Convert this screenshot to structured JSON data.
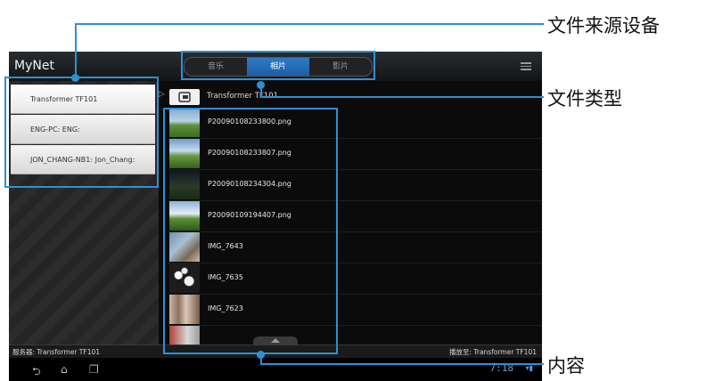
{
  "app": {
    "title": "MyNet"
  },
  "tabs": [
    {
      "label": "音乐",
      "active": false
    },
    {
      "label": "相片",
      "active": true
    },
    {
      "label": "影片",
      "active": false
    }
  ],
  "sources": [
    {
      "label": "Transformer TF101",
      "selected": true
    },
    {
      "label": "ENG-PC: ENG:",
      "selected": false
    },
    {
      "label": "JON_CHANG-NB1: Jon_Chang:",
      "selected": false
    }
  ],
  "path": {
    "label": "Transformer TF101"
  },
  "files": [
    {
      "name": "P20090108233800.png",
      "thumb": "landscape"
    },
    {
      "name": "P20090108233807.png",
      "thumb": "landscape"
    },
    {
      "name": "P20090108234304.png",
      "thumb": "dark-landscape"
    },
    {
      "name": "P20090109194407.png",
      "thumb": "landscape"
    },
    {
      "name": "IMG_7643",
      "thumb": "photo-blue"
    },
    {
      "name": "IMG_7635",
      "thumb": "photo-white"
    },
    {
      "name": "IMG_7623",
      "thumb": "photo-people"
    }
  ],
  "status": {
    "server": "服务器: Transformer TF101",
    "play_to": "播放至: Transformer TF101"
  },
  "system": {
    "clock": "7:18"
  },
  "annotations": {
    "source": "文件来源设备",
    "type": "文件类型",
    "content": "内容"
  },
  "colors": {
    "accent": "#2f8fd6",
    "tab_active": "#1d5ea6"
  }
}
